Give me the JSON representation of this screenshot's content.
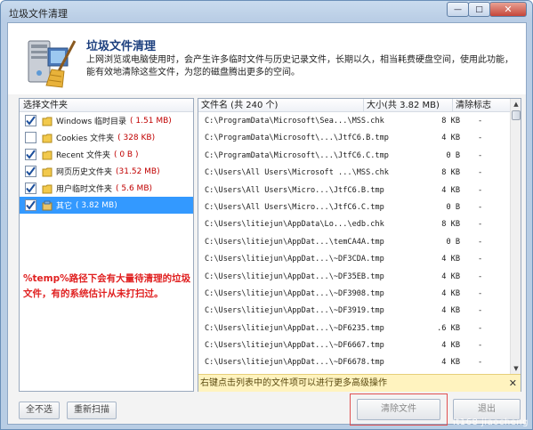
{
  "window": {
    "title": "垃圾文件清理",
    "btn_minimize": "—",
    "btn_maximize": "□",
    "btn_close": "✕"
  },
  "header": {
    "title": "垃圾文件清理",
    "description": "上网浏览或电脑使用时，会产生许多临时文件与历史记录文件，长期以久，相当耗费硬盘空间，使用此功能，能有效地清除这些文件，为您的磁盘腾出更多的空间。"
  },
  "left_panel": {
    "header": "选择文件夹",
    "categories": [
      {
        "label": "Windows 临时目录",
        "size": "( 1.51 MB)",
        "checked": true,
        "selected": false
      },
      {
        "label": "Cookies 文件夹",
        "size": "( 328 KB)",
        "checked": false,
        "selected": false
      },
      {
        "label": "Recent 文件夹",
        "size": "( 0 B )",
        "checked": true,
        "selected": false
      },
      {
        "label": "网页历史文件夹",
        "size": "(31.52 MB)",
        "checked": true,
        "selected": false
      },
      {
        "label": "用户临时文件夹",
        "size": "( 5.6 MB)",
        "checked": true,
        "selected": false
      },
      {
        "label": "其它",
        "size": "( 3.82 MB)",
        "checked": true,
        "selected": true
      }
    ],
    "annotation": "%temp%路径下会有大量待清理的垃圾文件，有的系统估计从未打扫过。"
  },
  "right_panel": {
    "columns": {
      "name": "文件名 (共 240 个)",
      "size": "大小(共 3.82 MB)",
      "mark": "清除标志"
    },
    "files": [
      {
        "path": "C:\\ProgramData\\Microsoft\\Sea...\\MSS.chk",
        "size": "8 KB",
        "mark": "-"
      },
      {
        "path": "C:\\ProgramData\\Microsoft\\...\\JtfC6.B.tmp",
        "size": "4 KB",
        "mark": "-"
      },
      {
        "path": "C:\\ProgramData\\Microsoft\\...\\JtfC6.C.tmp",
        "size": "0 B",
        "mark": "-"
      },
      {
        "path": "C:\\Users\\All Users\\Microsoft ...\\MSS.chk",
        "size": "8 KB",
        "mark": "-"
      },
      {
        "path": "C:\\Users\\All Users\\Micro...\\JtfC6.B.tmp",
        "size": "4 KB",
        "mark": "-"
      },
      {
        "path": "C:\\Users\\All Users\\Micro...\\JtfC6.C.tmp",
        "size": "0 B",
        "mark": "-"
      },
      {
        "path": "C:\\Users\\litiejun\\AppData\\Lo...\\edb.chk",
        "size": "8 KB",
        "mark": "-"
      },
      {
        "path": "C:\\Users\\litiejun\\AppDat...\\temCA4A.tmp",
        "size": "0 B",
        "mark": "-"
      },
      {
        "path": "C:\\Users\\litiejun\\AppDat...\\~DF3CDA.tmp",
        "size": "4 KB",
        "mark": "-"
      },
      {
        "path": "C:\\Users\\litiejun\\AppDat...\\~DF35EB.tmp",
        "size": "4 KB",
        "mark": "-"
      },
      {
        "path": "C:\\Users\\litiejun\\AppDat...\\~DF3908.tmp",
        "size": "4 KB",
        "mark": "-"
      },
      {
        "path": "C:\\Users\\litiejun\\AppDat...\\~DF3919.tmp",
        "size": "4 KB",
        "mark": "-"
      },
      {
        "path": "C:\\Users\\litiejun\\AppDat...\\~DF6235.tmp",
        "size": ".6 KB",
        "mark": "-"
      },
      {
        "path": "C:\\Users\\litiejun\\AppDat...\\~DF6667.tmp",
        "size": "4 KB",
        "mark": "-"
      },
      {
        "path": "C:\\Users\\litiejun\\AppDat...\\~DF6678.tmp",
        "size": "4 KB",
        "mark": "-"
      }
    ],
    "hint": "右键点击列表中的文件项可以进行更多高级操作",
    "hint_close": "✕"
  },
  "buttons": {
    "deselect_all": "全不选",
    "rescan": "重新扫描",
    "clean_files": "清除文件",
    "exit": "退出"
  },
  "watermark": "it168 jiaocheng"
}
